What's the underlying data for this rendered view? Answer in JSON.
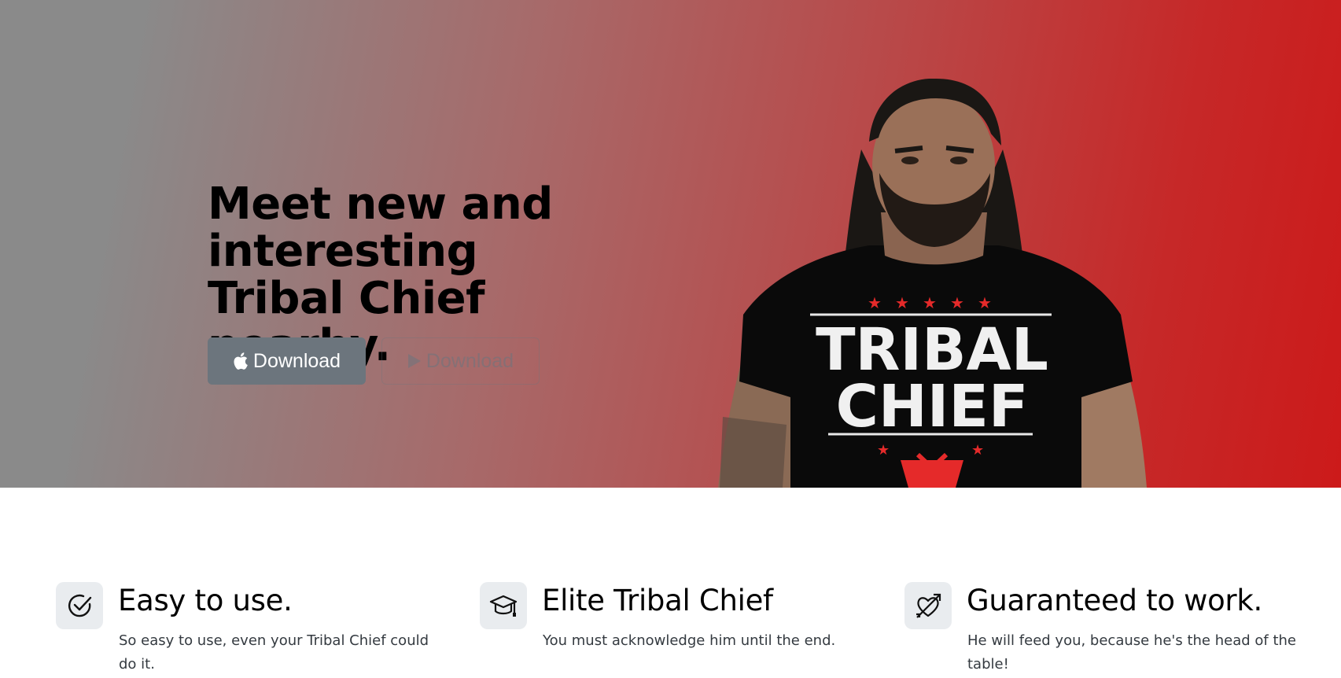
{
  "hero": {
    "title": "Meet new and interesting Tribal Chief nearby.",
    "buttons": [
      {
        "label": "Download",
        "icon": "apple-icon"
      },
      {
        "label": "Download",
        "icon": "play-icon"
      }
    ],
    "image": {
      "alt": "Tribal Chief",
      "shirt_line1": "TRIBAL",
      "shirt_line2": "CHIEF"
    },
    "colors": {
      "gradient_start": "#8a8a8a",
      "gradient_end": "#cc1a1a",
      "button": "#6c757d"
    }
  },
  "features": [
    {
      "icon": "check-circle-icon",
      "title": "Easy to use.",
      "text": "So easy to use, even your Tribal Chief could do it."
    },
    {
      "icon": "graduation-cap-icon",
      "title": "Elite Tribal Chief",
      "text": "You must acknowledge him until the end."
    },
    {
      "icon": "heart-arrow-icon",
      "title": "Guaranteed to work.",
      "text": "He will feed you, because he's the head of the table!"
    }
  ]
}
